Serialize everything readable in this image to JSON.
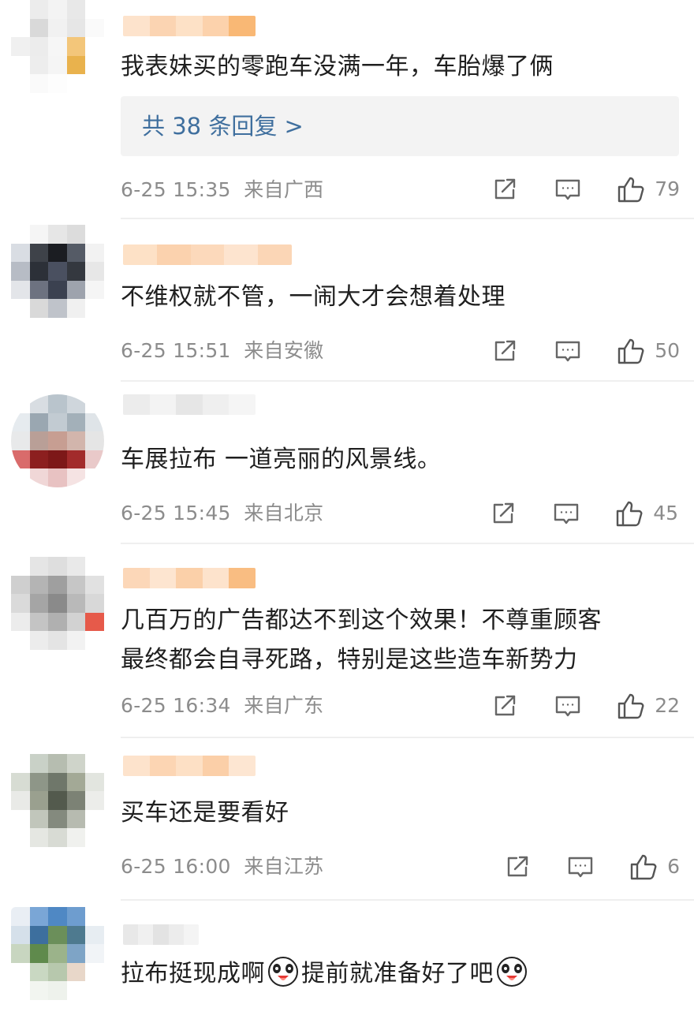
{
  "comments": [
    {
      "text": "我表妹买的零跑车没满一年，车胎爆了俩",
      "reply_link": "共 38 条回复 >",
      "time": "6-25 15:35",
      "location": "来自广西",
      "likes": "79",
      "avatar_colors": [
        "#ffffff",
        "#ececec",
        "#f3f3f3",
        "#e8e8e8",
        "#ffffff",
        "#ffffff",
        "#d9d9d9",
        "#f1f1f1",
        "#e6e6e6",
        "#fafafa",
        "#f0f0f0",
        "#ececec",
        "#f6f6f6",
        "#f3c67a",
        "#ffffff",
        "#ffffff",
        "#ededed",
        "#f5f5f5",
        "#e9b24d",
        "#ffffff",
        "#ffffff",
        "#fafafa",
        "#fdfdfd",
        "#ffffff",
        "#ffffff"
      ],
      "name_colors": [
        "#fde3cc",
        "#fbd4b2",
        "#fde1c6",
        "#fcd2ac",
        "#f9b875"
      ]
    },
    {
      "text": "不维权就不管，一闹大才会想着处理",
      "time": "6-25 15:51",
      "location": "来自安徽",
      "likes": "50",
      "avatar_colors": [
        "#ffffff",
        "#f5f5f5",
        "#e6e6e6",
        "#dcdcdc",
        "#ffffff",
        "#d9dde3",
        "#3e4249",
        "#1b1d22",
        "#555b66",
        "#f2f2f2",
        "#b7bcc5",
        "#2c3038",
        "#4a5060",
        "#34383f",
        "#e7e7e7",
        "#e3e5e9",
        "#6d7280",
        "#3b4150",
        "#9ea3ad",
        "#f5f5f5",
        "#ffffff",
        "#d9d9d9",
        "#bfc3ca",
        "#f0f0f0",
        "#ffffff"
      ],
      "name_colors": [
        "#fde1c6",
        "#fbd2ae",
        "#fcd9bb",
        "#fde4cf",
        "#fbd6b6"
      ]
    },
    {
      "text": "车展拉布  一道亮丽的风景线。",
      "time": "6-25 15:45",
      "location": "来自北京",
      "likes": "45",
      "avatar_colors": [
        "#ffffff",
        "#d8dde2",
        "#b9c4cc",
        "#cfd6dc",
        "#ffffff",
        "#e6ebef",
        "#9aa7b1",
        "#c2cbd2",
        "#a3b0b9",
        "#dfe4e8",
        "#e8e9ea",
        "#b99f97",
        "#c79e92",
        "#d2b5ac",
        "#e5e5e5",
        "#d96b6b",
        "#8c1f1f",
        "#7d1818",
        "#a22b2b",
        "#e9c9c9",
        "#ffffff",
        "#f0d7d7",
        "#e8c2c2",
        "#f5e3e3",
        "#ffffff"
      ],
      "name_colors": [
        "#ececec",
        "#f3f3f3",
        "#e6e6e6",
        "#efefef",
        "#f5f5f5"
      ]
    },
    {
      "text_lines": [
        "几百万的广告都达不到这个效果！不尊重顾客",
        "最终都会自寻死路，特别是这些造车新势力"
      ],
      "time": "6-25 16:34",
      "location": "来自广东",
      "likes": "22",
      "avatar_colors": [
        "#ffffff",
        "#e5e5e5",
        "#dedede",
        "#e9e9e9",
        "#ffffff",
        "#cfcfcf",
        "#b4b4b4",
        "#9f9f9f",
        "#c6c6c6",
        "#e1e1e1",
        "#dadada",
        "#a5a5a5",
        "#8a8a8a",
        "#b9b9b9",
        "#d8d8d8",
        "#ececec",
        "#c4c4c4",
        "#b0b0b0",
        "#d2d2d2",
        "#e65a4a",
        "#ffffff",
        "#ececec",
        "#e4e4e4",
        "#f2f2f2",
        "#ffffff"
      ],
      "name_colors": [
        "#fcd7b8",
        "#fde5d0",
        "#fbd0a9",
        "#fde3cc",
        "#f9bd82"
      ]
    },
    {
      "text": "买车还是要看好",
      "time": "6-25 16:00",
      "location": "来自江苏",
      "likes": "6",
      "avatar_colors": [
        "#ffffff",
        "#c9d1c7",
        "#b6bdb0",
        "#cfd4ca",
        "#ffffff",
        "#d7dcd3",
        "#8e9688",
        "#6f776a",
        "#a3a996",
        "#e2e5df",
        "#e9eae7",
        "#9aa08f",
        "#535a4d",
        "#7c8275",
        "#ecedea",
        "#ffffff",
        "#c1c6bb",
        "#848a7e",
        "#b7bbb0",
        "#ffffff",
        "#ffffff",
        "#e5e7e2",
        "#d8dbd4",
        "#f0f1ee",
        "#ffffff"
      ],
      "name_colors": [
        "#fde3cc",
        "#fcd5b3",
        "#fde0c5",
        "#fbcfa8",
        "#fde6d2"
      ]
    },
    {
      "text_parts": [
        "拉布挺现成啊",
        "提前就准备好了吧"
      ],
      "avatar_colors": [
        "#e9eef4",
        "#7aa6d6",
        "#4f88c4",
        "#6e9dcf",
        "#ffffff",
        "#d5e0ea",
        "#3d6f9e",
        "#6b8f5a",
        "#4e7a8f",
        "#e7edf2",
        "#c8d6c0",
        "#5f8a4c",
        "#9bb38a",
        "#7ea4c6",
        "#f1f4f7",
        "#ffffff",
        "#c9d8c2",
        "#b7c8ad",
        "#e8d7c9",
        "#ffffff",
        "#ffffff",
        "#f2f5f0",
        "#eef2ec",
        "#ffffff",
        "#ffffff"
      ],
      "name_colors": [
        "#e8e8e8",
        "#f0f0f0",
        "#e3e3e3",
        "#ececec",
        "#f4f4f4"
      ]
    }
  ]
}
